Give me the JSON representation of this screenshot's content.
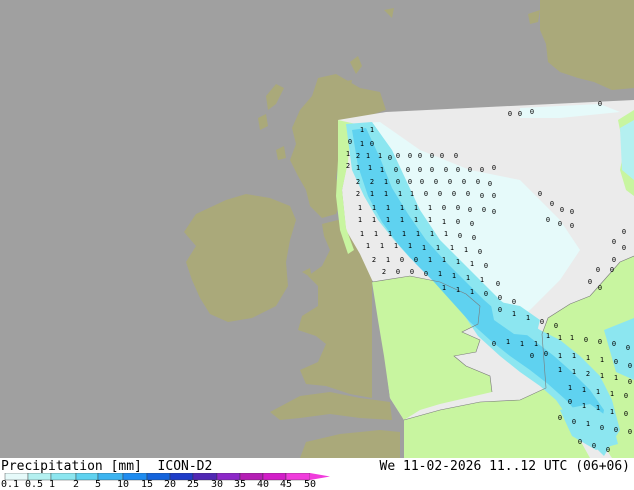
{
  "legend": {
    "title": "Precipitation [mm]",
    "model": "ICON-D2",
    "datetime": "We 11-02-2026 11..12 UTC (06+06)",
    "scale_labels": [
      "0.1",
      "0.5",
      "1",
      "2",
      "5",
      "10",
      "15",
      "20",
      "25",
      "30",
      "35",
      "40",
      "45",
      "50"
    ],
    "scale_colors": [
      "#e6fafa",
      "#b4f0f0",
      "#8ce6f0",
      "#5fd2f0",
      "#3cb4f0",
      "#1e8cf0",
      "#1464dc",
      "#1e3cc8",
      "#5028b4",
      "#8c28c8",
      "#b41eb4",
      "#d21ec8",
      "#f03cdc"
    ]
  },
  "colors": {
    "ocean": "#a0a0a0",
    "land": "#aaa97a",
    "domain_background": "#ebebeb",
    "dry_land": "#c8f5a0",
    "light_precip": "#e6fafa",
    "precip_cyan": "#5fd2f0"
  },
  "precip_values_visible": [
    "0",
    "1",
    "2"
  ]
}
